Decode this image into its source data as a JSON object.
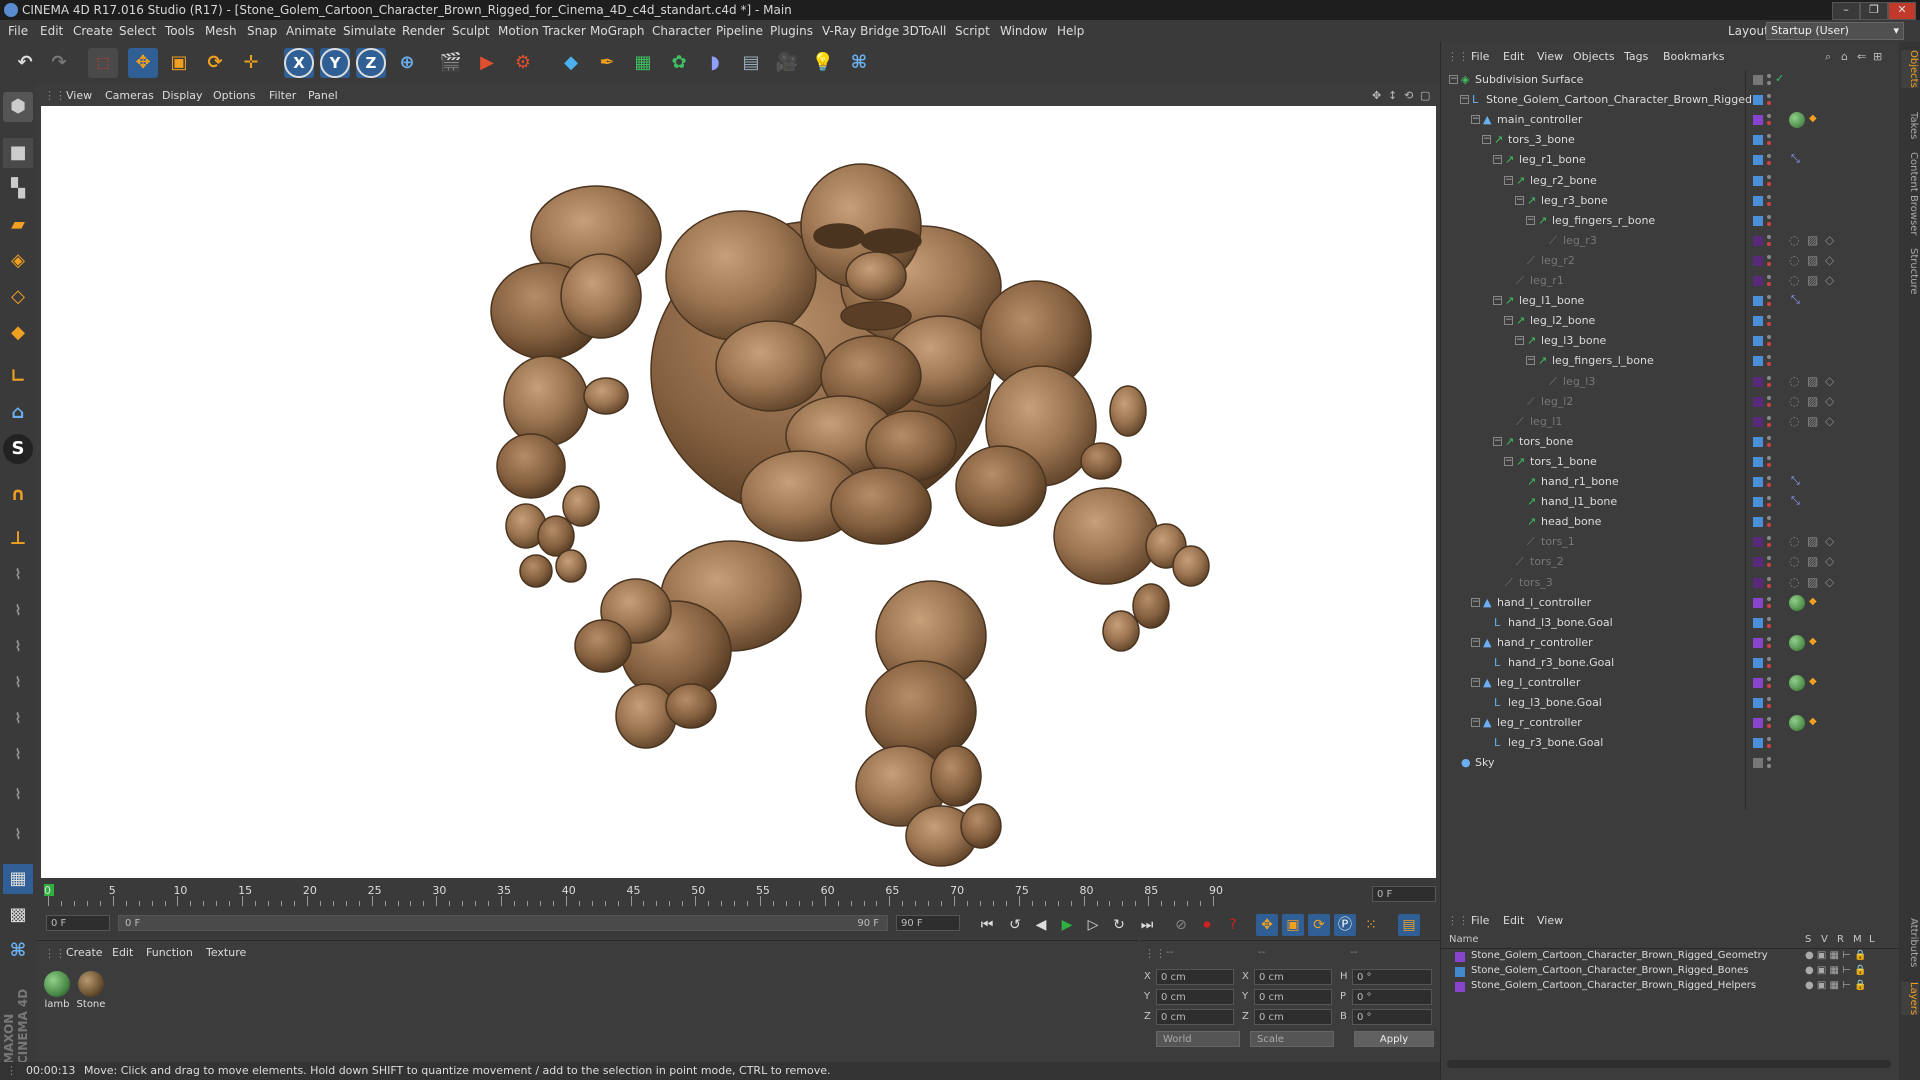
{
  "window": {
    "title": "CINEMA 4D R17.016 Studio (R17) - [Stone_Golem_Cartoon_Character_Brown_Rigged_for_Cinema_4D_c4d_standart.c4d *] - Main",
    "minimize": "–",
    "maximize": "❐",
    "close": "✕"
  },
  "menubar": {
    "items": [
      "File",
      "Edit",
      "Create",
      "Select",
      "Tools",
      "Mesh",
      "Snap",
      "Animate",
      "Simulate",
      "Render",
      "Sculpt",
      "Motion Tracker",
      "MoGraph",
      "Character",
      "Pipeline",
      "Plugins",
      "V-Ray Bridge",
      "3DToAll",
      "Script",
      "Window",
      "Help"
    ],
    "layout_label": "Layout:",
    "layout_value": "Startup (User)"
  },
  "toolbar": {
    "axis_x": "X",
    "axis_y": "Y",
    "axis_z": "Z"
  },
  "left_tools": {
    "solo_label": "S"
  },
  "viewport": {
    "menu": [
      "View",
      "Cameras",
      "Display",
      "Options",
      "Filter",
      "Panel"
    ]
  },
  "timeline": {
    "ticks": [
      "0",
      "5",
      "10",
      "15",
      "20",
      "25",
      "30",
      "35",
      "40",
      "45",
      "50",
      "55",
      "60",
      "65",
      "70",
      "75",
      "80",
      "85",
      "90"
    ],
    "current_frame": "0 F"
  },
  "transport": {
    "start_frame": "0 F",
    "range_start": "0 F",
    "range_end": "90 F",
    "end_frame": "90 F"
  },
  "material_panel": {
    "menu": [
      "Create",
      "Edit",
      "Function",
      "Texture"
    ],
    "materials": [
      {
        "label": "lamb",
        "color": "#4a8a48"
      },
      {
        "label": "Stone",
        "color": "#6a5232"
      }
    ]
  },
  "coord_panel": {
    "headers": [
      "--",
      "--",
      "--"
    ],
    "rows": [
      {
        "l1": "X",
        "v1": "0 cm",
        "l2": "X",
        "v2": "0 cm",
        "l3": "H",
        "v3": "0 °"
      },
      {
        "l1": "Y",
        "v1": "0 cm",
        "l2": "Y",
        "v2": "0 cm",
        "l3": "P",
        "v3": "0 °"
      },
      {
        "l1": "Z",
        "v1": "0 cm",
        "l2": "Z",
        "v2": "0 cm",
        "l3": "B",
        "v3": "0 °"
      }
    ],
    "space": "World",
    "mode": "Scale",
    "apply": "Apply"
  },
  "status": {
    "time": "00:00:13",
    "message": "Move: Click and drag to move elements. Hold down SHIFT to quantize movement / add to the selection in point mode, CTRL to remove."
  },
  "object_manager": {
    "menu": [
      "File",
      "Edit",
      "View",
      "Objects",
      "Tags",
      "Bookmarks"
    ],
    "rows": [
      {
        "label": "Subdivision Surface",
        "indent": 0,
        "type": "subdiv",
        "dim": false,
        "tag": ""
      },
      {
        "label": "Stone_Golem_Cartoon_Character_Brown_Rigged",
        "indent": 1,
        "type": "null",
        "dim": false,
        "tag": ""
      },
      {
        "label": "main_controller",
        "indent": 2,
        "type": "ctrl",
        "dim": false,
        "tag": "ctrl"
      },
      {
        "label": "tors_3_bone",
        "indent": 3,
        "type": "bone",
        "dim": false,
        "tag": ""
      },
      {
        "label": "leg_r1_bone",
        "indent": 4,
        "type": "bone",
        "dim": false,
        "tag": "ik"
      },
      {
        "label": "leg_r2_bone",
        "indent": 5,
        "type": "bone",
        "dim": false,
        "tag": ""
      },
      {
        "label": "leg_r3_bone",
        "indent": 6,
        "type": "bone",
        "dim": false,
        "tag": ""
      },
      {
        "label": "leg_fingers_r_bone",
        "indent": 7,
        "type": "bone",
        "dim": false,
        "tag": ""
      },
      {
        "label": "leg_r3",
        "indent": 8,
        "type": "joint",
        "dim": true,
        "tag": "multi"
      },
      {
        "label": "leg_r2",
        "indent": 6,
        "type": "joint",
        "dim": true,
        "tag": "multi"
      },
      {
        "label": "leg_r1",
        "indent": 5,
        "type": "joint",
        "dim": true,
        "tag": "multi"
      },
      {
        "label": "leg_l1_bone",
        "indent": 4,
        "type": "bone",
        "dim": false,
        "tag": "ik"
      },
      {
        "label": "leg_l2_bone",
        "indent": 5,
        "type": "bone",
        "dim": false,
        "tag": ""
      },
      {
        "label": "leg_l3_bone",
        "indent": 6,
        "type": "bone",
        "dim": false,
        "tag": ""
      },
      {
        "label": "leg_fingers_l_bone",
        "indent": 7,
        "type": "bone",
        "dim": false,
        "tag": ""
      },
      {
        "label": "leg_l3",
        "indent": 8,
        "type": "joint",
        "dim": true,
        "tag": "multi"
      },
      {
        "label": "leg_l2",
        "indent": 6,
        "type": "joint",
        "dim": true,
        "tag": "multi"
      },
      {
        "label": "leg_l1",
        "indent": 5,
        "type": "joint",
        "dim": true,
        "tag": "multi"
      },
      {
        "label": "tors_bone",
        "indent": 4,
        "type": "bone",
        "dim": false,
        "tag": ""
      },
      {
        "label": "tors_1_bone",
        "indent": 5,
        "type": "bone",
        "dim": false,
        "tag": ""
      },
      {
        "label": "hand_r1_bone",
        "indent": 6,
        "type": "bone",
        "dim": false,
        "tag": "ik"
      },
      {
        "label": "hand_l1_bone",
        "indent": 6,
        "type": "bone",
        "dim": false,
        "tag": "ik"
      },
      {
        "label": "head_bone",
        "indent": 6,
        "type": "bone",
        "dim": false,
        "tag": ""
      },
      {
        "label": "tors_1",
        "indent": 6,
        "type": "joint",
        "dim": true,
        "tag": "multi"
      },
      {
        "label": "tors_2",
        "indent": 5,
        "type": "joint",
        "dim": true,
        "tag": "multi"
      },
      {
        "label": "tors_3",
        "indent": 4,
        "type": "joint",
        "dim": true,
        "tag": "multi"
      },
      {
        "label": "hand_l_controller",
        "indent": 2,
        "type": "ctrl",
        "dim": false,
        "tag": "ctrl"
      },
      {
        "label": "hand_l3_bone.Goal",
        "indent": 3,
        "type": "null",
        "dim": false,
        "tag": ""
      },
      {
        "label": "hand_r_controller",
        "indent": 2,
        "type": "ctrl",
        "dim": false,
        "tag": "ctrl"
      },
      {
        "label": "hand_r3_bone.Goal",
        "indent": 3,
        "type": "null",
        "dim": false,
        "tag": ""
      },
      {
        "label": "leg_l_controller",
        "indent": 2,
        "type": "ctrl",
        "dim": false,
        "tag": "ctrl"
      },
      {
        "label": "leg_l3_bone.Goal",
        "indent": 3,
        "type": "null",
        "dim": false,
        "tag": ""
      },
      {
        "label": "leg_r_controller",
        "indent": 2,
        "type": "ctrl",
        "dim": false,
        "tag": "ctrl"
      },
      {
        "label": "leg_r3_bone.Goal",
        "indent": 3,
        "type": "null",
        "dim": false,
        "tag": ""
      },
      {
        "label": "Sky",
        "indent": 0,
        "type": "sky",
        "dim": false,
        "tag": ""
      }
    ]
  },
  "side_tabs": [
    "Objects",
    "Takes",
    "Content Browser",
    "Structure"
  ],
  "side_tabs_lower": [
    "Attributes",
    "Layers"
  ],
  "layer_manager": {
    "menu": [
      "File",
      "Edit",
      "View"
    ],
    "name_header": "Name",
    "col_headers": [
      "S",
      "V",
      "R",
      "M",
      "L"
    ],
    "layers": [
      {
        "name": "Stone_Golem_Cartoon_Character_Brown_Rigged_Geometry",
        "color": "#8844cc"
      },
      {
        "name": "Stone_Golem_Cartoon_Character_Brown_Rigged_Bones",
        "color": "#4488cc"
      },
      {
        "name": "Stone_Golem_Cartoon_Character_Brown_Rigged_Helpers",
        "color": "#8844cc"
      }
    ]
  },
  "colors": {
    "accent": "#4a8fd8",
    "bone": "#2fb56a",
    "play": "#2fb040",
    "record": "#d02020"
  }
}
